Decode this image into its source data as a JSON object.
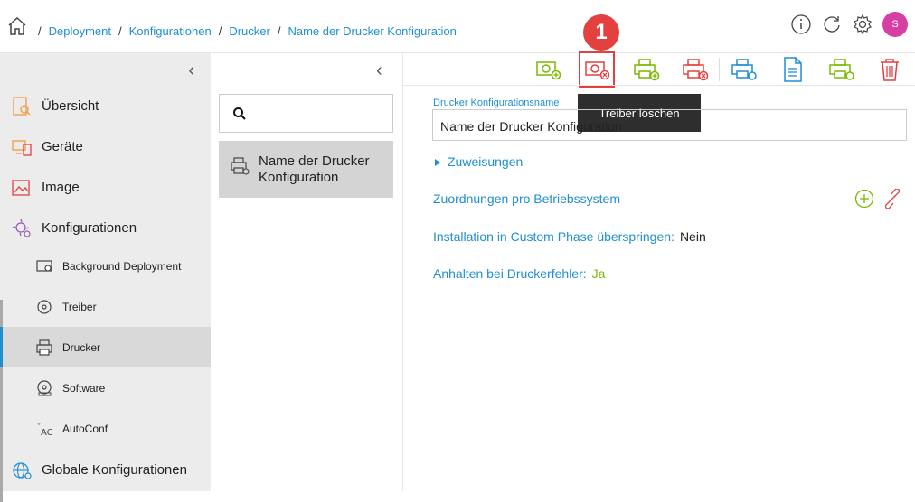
{
  "breadcrumb": [
    "Deployment",
    "Konfigurationen",
    "Drucker",
    "Name der Drucker Konfiguration"
  ],
  "user": {
    "initial": "S",
    "color": "#d63fa4"
  },
  "sidebar": {
    "items": [
      {
        "label": "Übersicht"
      },
      {
        "label": "Geräte"
      },
      {
        "label": "Image"
      },
      {
        "label": "Konfigurationen"
      }
    ],
    "sub_items": [
      {
        "label": "Background Deployment"
      },
      {
        "label": "Treiber"
      },
      {
        "label": "Drucker",
        "active": true
      },
      {
        "label": "Software"
      },
      {
        "label": "AutoConf"
      }
    ],
    "global_label": "Globale Konfigurationen"
  },
  "list": {
    "selected": "Name der Drucker Konfiguration"
  },
  "toolbar": {
    "tooltip": "Treiber löschen",
    "badge": "1"
  },
  "form": {
    "name_label": "Drucker Konfigurationsname",
    "name_value": "Name der Drucker Konfiguration",
    "assignments_label": "Zuweisungen",
    "os_mapping_label": "Zuordnungen pro Betriebssystem",
    "skip_custom_label": "Installation in Custom Phase überspringen:",
    "skip_custom_value": "Nein",
    "halt_on_error_label": "Anhalten bei Druckerfehler:",
    "halt_on_error_value": "Ja"
  },
  "colors": {
    "accent": "#1f8fd1",
    "success": "#7ab800",
    "danger": "#e34040"
  }
}
